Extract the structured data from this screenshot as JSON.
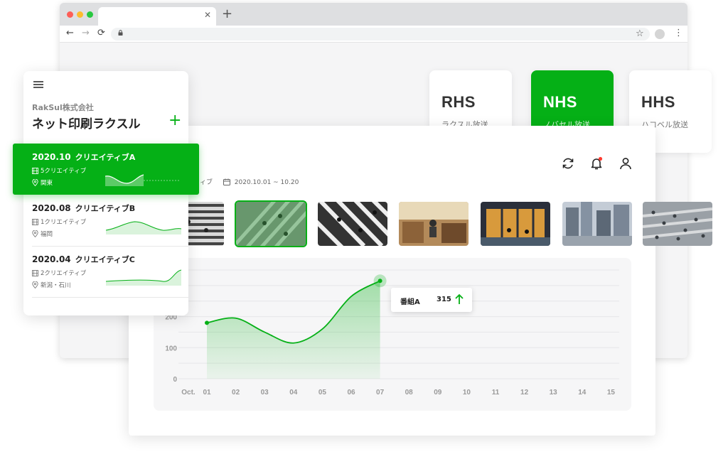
{
  "channels": [
    {
      "code": "RHS",
      "name": "ラクスル放送"
    },
    {
      "code": "NHS",
      "name": "ノバセル放送"
    },
    {
      "code": "HHS",
      "name": "ハコベル放送"
    }
  ],
  "sidebar": {
    "company": "RakSul株式会社",
    "app_name": "ネット印刷ラクスル",
    "add_icon": "plus-icon",
    "items": [
      {
        "date": "2020.10",
        "name": "クリエイティブA",
        "creatives": "5クリエイティブ",
        "region": "関東"
      },
      {
        "date": "2020.08",
        "name": "クリエイティブB",
        "creatives": "1クリエイティブ",
        "region": "福岡"
      },
      {
        "date": "2020.04",
        "name": "クリエイティブC",
        "creatives": "2クリエイティブ",
        "region": "新潟・石川"
      }
    ]
  },
  "main": {
    "creative_partial": "ィブ",
    "period": "2020.10.01 ~ 10.20",
    "icons": [
      "refresh-icon",
      "bell-icon",
      "user-icon"
    ]
  },
  "tooltip": {
    "name": "番組A",
    "value": "315"
  },
  "colors": {
    "accent": "#05b016",
    "notification": "#ff3b30"
  },
  "chart_data": {
    "type": "area",
    "x_label_prefix": "Oct.",
    "x_ticks": [
      "01",
      "02",
      "03",
      "04",
      "05",
      "06",
      "07",
      "08",
      "09",
      "10",
      "11",
      "12",
      "13",
      "14",
      "15"
    ],
    "y_ticks": [
      "0",
      "100",
      "200"
    ],
    "ylim": [
      0,
      350
    ],
    "grid": true,
    "series": [
      {
        "name": "番組A",
        "x": [
          "01",
          "02",
          "03",
          "04",
          "05",
          "06",
          "07"
        ],
        "values": [
          180,
          195,
          150,
          115,
          160,
          265,
          315
        ]
      }
    ]
  }
}
